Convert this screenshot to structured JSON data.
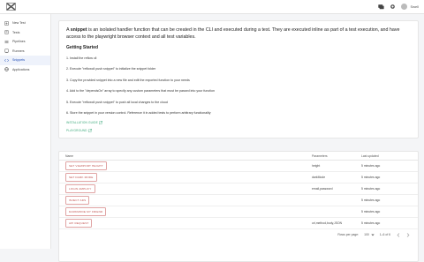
{
  "header": {
    "user_name": "Swell"
  },
  "sidebar": {
    "items": [
      {
        "label": "New Test",
        "icon": "plus-icon",
        "active": false
      },
      {
        "label": "Tests",
        "icon": "document-icon",
        "active": false
      },
      {
        "label": "Pipelines",
        "icon": "pipeline-icon",
        "active": false
      },
      {
        "label": "Runners",
        "icon": "runner-icon",
        "active": false
      },
      {
        "label": "Snippets",
        "icon": "snippet-icon",
        "active": true
      },
      {
        "label": "Applications",
        "icon": "globe-icon",
        "active": false
      }
    ]
  },
  "intro": {
    "prefix": "A ",
    "bold": "snippet",
    "text": " is an isolated handler function that can be created in the CLI and executed during a test. They are executed inline as part of a test execution, and have access to the playwright browser context and all test variables.",
    "getting_started": "Getting Started",
    "steps": [
      "1. Install the reflow cli",
      "2. Execute \"reflowcli push snippet\" to initialize the snippet folder",
      "3. Copy the provided snippet into a new file and edit the exported function to your needs",
      "4. Add to the \"dependsOn\" array to specify any custom parameters that must be passed into your function",
      "5. Execute \"reflowcli push snippet\" to push all local changes to the cloud",
      "6. Store the snippet in your version control. Reference it in added tests to perform arbitrary functionality"
    ],
    "links": [
      "INSTALLATION GUIDE",
      "PLAYGROUND"
    ]
  },
  "table": {
    "headers": {
      "name": "Name",
      "params": "Parameters",
      "updated": "Last updated"
    },
    "rows": [
      {
        "name": "SET VIEWPORT HEIGHT",
        "params": "height",
        "updated": "5 minutes ago"
      },
      {
        "name": "SET DARK MODE",
        "params": "darkMode",
        "updated": "5 minutes ago"
      },
      {
        "name": "LOGIN AMPLIFY",
        "params": "email,password",
        "updated": "5 minutes ago"
      },
      {
        "name": "INJECT ADS",
        "params": "",
        "updated": "5 minutes ago"
      },
      {
        "name": "DARKMODE MY FRIEND",
        "params": "",
        "updated": "5 minutes ago"
      },
      {
        "name": "API REQUEST",
        "params": "url,method,body,JSON",
        "updated": "5 minutes ago"
      }
    ],
    "footer": {
      "rows_per_page_label": "Rows per page:",
      "rows_per_page_value": "100",
      "range": "1–6 of 6"
    }
  },
  "colors": {
    "accent": "#1f4db6",
    "chip": "#c0504d",
    "link": "#3aa87a"
  }
}
